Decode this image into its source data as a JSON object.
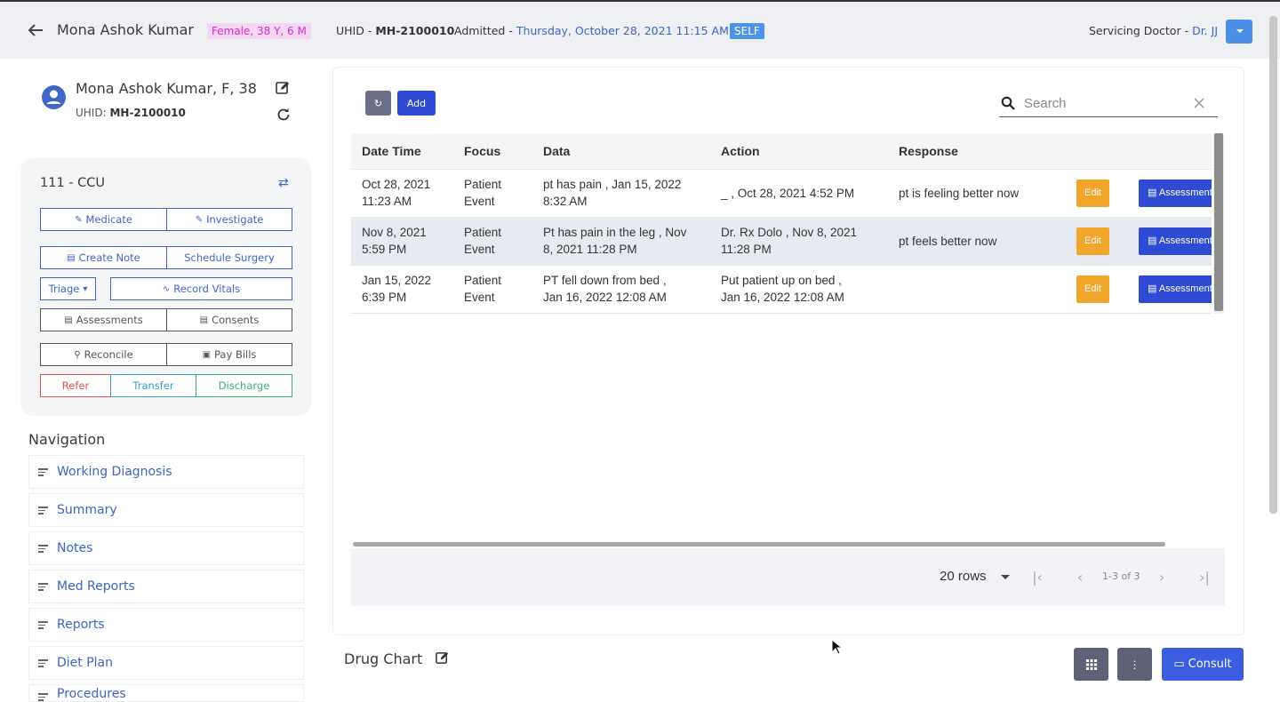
{
  "header": {
    "patient_name": "Mona Ashok Kumar",
    "gender_age": "Female, 38 Y, 6 M",
    "uhid_label": "UHID - ",
    "uhid": "MH-2100010",
    "admitted_label": "Admitted - ",
    "admitted_date": "Thursday, October 28, 2021 11:15 AM",
    "self_badge": "SELF",
    "servicing_label": "Servicing Doctor - ",
    "servicing_doctor": "Dr. JJ"
  },
  "patient_card": {
    "name": "Mona Ashok Kumar, F, 38",
    "uhid_label": "UHID: ",
    "uhid": "MH-2100010"
  },
  "bed": "111 - CCU",
  "actions": {
    "medicate": "Medicate",
    "investigate": "Investigate",
    "create_note": "Create Note",
    "schedule_surgery": "Schedule Surgery",
    "triage": "Triage",
    "record_vitals": "Record Vitals",
    "assessments": "Assessments",
    "consents": "Consents",
    "reconcile": "Reconcile",
    "pay_bills": "Pay Bills",
    "refer": "Refer",
    "transfer": "Transfer",
    "discharge": "Discharge"
  },
  "navigation": {
    "title": "Navigation",
    "items": [
      {
        "label": "Working Diagnosis"
      },
      {
        "label": "Summary"
      },
      {
        "label": "Notes"
      },
      {
        "label": "Med Reports"
      },
      {
        "label": "Reports"
      },
      {
        "label": "Diet Plan"
      },
      {
        "label": "Procedures"
      }
    ]
  },
  "toolbar": {
    "add_label": "Add",
    "search_placeholder": "Search"
  },
  "table": {
    "columns": [
      "Date Time",
      "Focus",
      "Data",
      "Action",
      "Response"
    ],
    "edit_label": "Edit",
    "assess_label": "Assessment",
    "rows": [
      {
        "date1": "Oct 28, 2021",
        "date2": "11:23 AM",
        "focus1": "Patient",
        "focus2": "Event",
        "data1": "pt has pain , Jan 15, 2022",
        "data2": "8:32 AM",
        "action1": "_ , Oct 28, 2021 4:52 PM",
        "action2": "",
        "response": "pt is feeling better now"
      },
      {
        "date1": "Nov 8, 2021",
        "date2": "5:59 PM",
        "focus1": "Patient",
        "focus2": "Event",
        "data1": "Pt has pain in the leg , Nov",
        "data2": "8, 2021 11:28 PM",
        "action1": "Dr. Rx Dolo , Nov 8, 2021",
        "action2": "11:28 PM",
        "response": "pt feels better now"
      },
      {
        "date1": "Jan 15, 2022",
        "date2": "6:39 PM",
        "focus1": "Patient",
        "focus2": "Event",
        "data1": "PT fell down from bed ,",
        "data2": "Jan 16, 2022 12:08 AM",
        "action1": "Put patient up on bed ,",
        "action2": "Jan 16, 2022 12:08 AM",
        "response": ""
      }
    ]
  },
  "pagination": {
    "rows_per_page": "20 rows",
    "count": "1-3 of 3"
  },
  "drug_chart": {
    "title": "Drug Chart"
  },
  "footer": {
    "consult_label": "Consult"
  }
}
